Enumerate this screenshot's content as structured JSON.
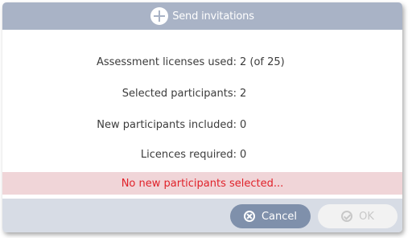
{
  "dialog": {
    "title": "Send invitations",
    "title_icon": "plus-circle-icon"
  },
  "stats": [
    {
      "label": "Assessment licenses used:",
      "value": "2 (of 25)"
    },
    {
      "label": "Selected participants:",
      "value": "2"
    },
    {
      "label": "New participants included:",
      "value": "0"
    },
    {
      "label": "Licences required:",
      "value": "0"
    }
  ],
  "warning": {
    "text": "No new participants selected...",
    "color": "#e0222a",
    "background": "#f0d5d8"
  },
  "footer": {
    "cancel_label": "Cancel",
    "cancel_icon": "cancel-circle-icon",
    "ok_label": "OK",
    "ok_icon": "check-circle-icon",
    "ok_enabled": false
  },
  "colors": {
    "titlebar": "#a9b3c6",
    "cancel_button": "#7f90ab",
    "footer": "#d7dce5"
  }
}
